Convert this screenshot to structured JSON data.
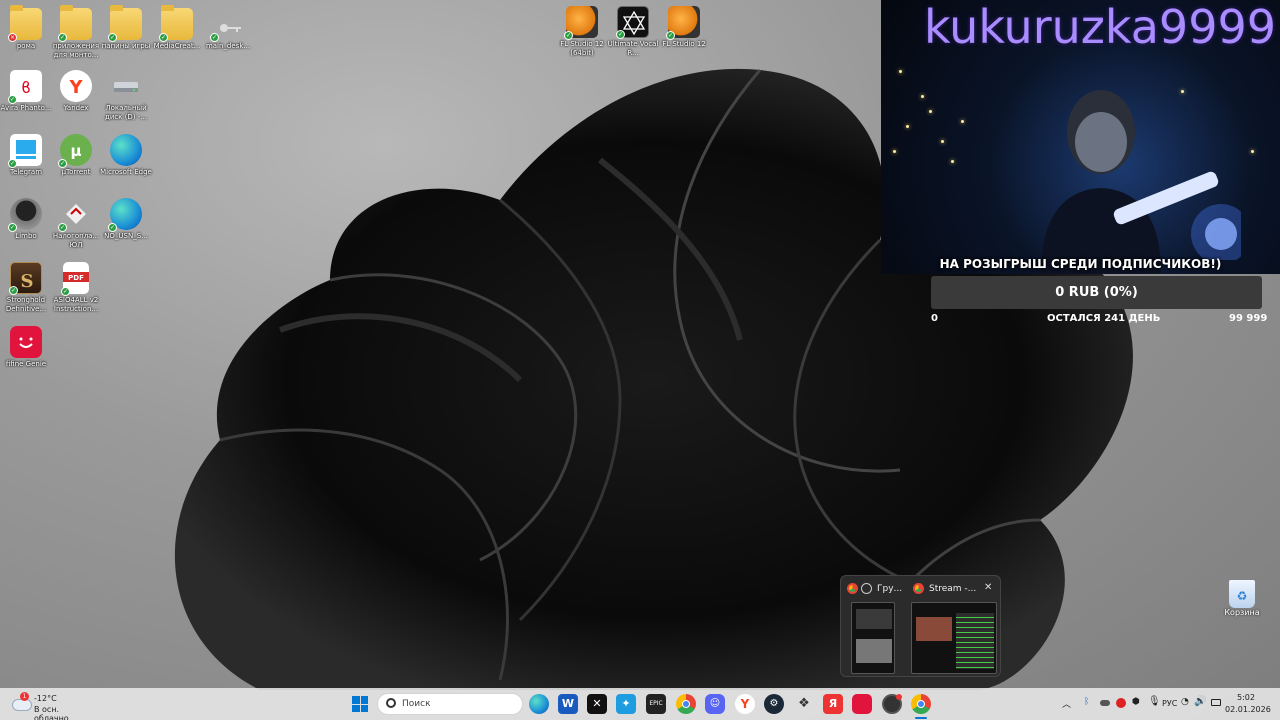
{
  "desktop": {
    "icons": [
      {
        "label": "рома",
        "icon": "folder-icon"
      },
      {
        "label": "приложения для монто...",
        "icon": "folder-icon"
      },
      {
        "label": "папины игры",
        "icon": "folder-icon"
      },
      {
        "label": "MediaCreat...",
        "icon": "folder-icon"
      },
      {
        "label": "main_desk...",
        "icon": "key-icon"
      },
      {
        "label": "Avira Phanto...",
        "icon": "avira-icon"
      },
      {
        "label": "Yandex",
        "icon": "yandex-icon"
      },
      {
        "label": "Локальный диск (D) -...",
        "icon": "drive-icon"
      },
      {
        "label": "Telegram",
        "icon": "telegram-icon"
      },
      {
        "label": "µTorrent",
        "icon": "utorrent-icon"
      },
      {
        "label": "Microsoft Edge",
        "icon": "edge-icon"
      },
      {
        "label": "Limbo",
        "icon": "limbo-icon"
      },
      {
        "label": "Налогопла... ЮЛ",
        "icon": "tax-icon"
      },
      {
        "label": "NO_USN_S...",
        "icon": "edge-icon"
      },
      {
        "label": "Stronghold Definitive...",
        "icon": "stronghold-icon"
      },
      {
        "label": "ASIO4ALL v2 Instruction...",
        "icon": "pdf-icon"
      },
      {
        "label": "fifine Genie",
        "icon": "fifine-icon"
      },
      {
        "label": "FL Studio 12 (64bit)",
        "icon": "fl-studio-icon"
      },
      {
        "label": "Ultimate Vocal R...",
        "icon": "uvr-icon"
      },
      {
        "label": "FL Studio 12",
        "icon": "fl-studio-icon"
      }
    ],
    "recycle_bin": "Корзина"
  },
  "stream": {
    "streamer": "kukuruzka9999",
    "goal_title": "НА РОЗЫГРЫШ СРЕДИ ПОДПИСЧИКОВ!)",
    "goal_amount": "0 RUB (0%)",
    "goal_min": "0",
    "goal_remaining": "ОСТАЛСЯ 241 ДЕНЬ",
    "goal_max": "99 999",
    "goal_progress": 0
  },
  "preview": {
    "window1_title": "Гру...",
    "window2_title": "Stream -..."
  },
  "taskbar": {
    "search_placeholder": "Поиск",
    "weather_badge": "1",
    "temperature": "-12°C",
    "weather_desc": "В осн. облачно",
    "language": "РУС",
    "time": "5:02",
    "date": "02.01.2026",
    "colors": {
      "accent": "#0078d4",
      "chrome_red": "#ea4335",
      "chrome_green": "#34a853",
      "chrome_yellow": "#fbbc05"
    }
  }
}
